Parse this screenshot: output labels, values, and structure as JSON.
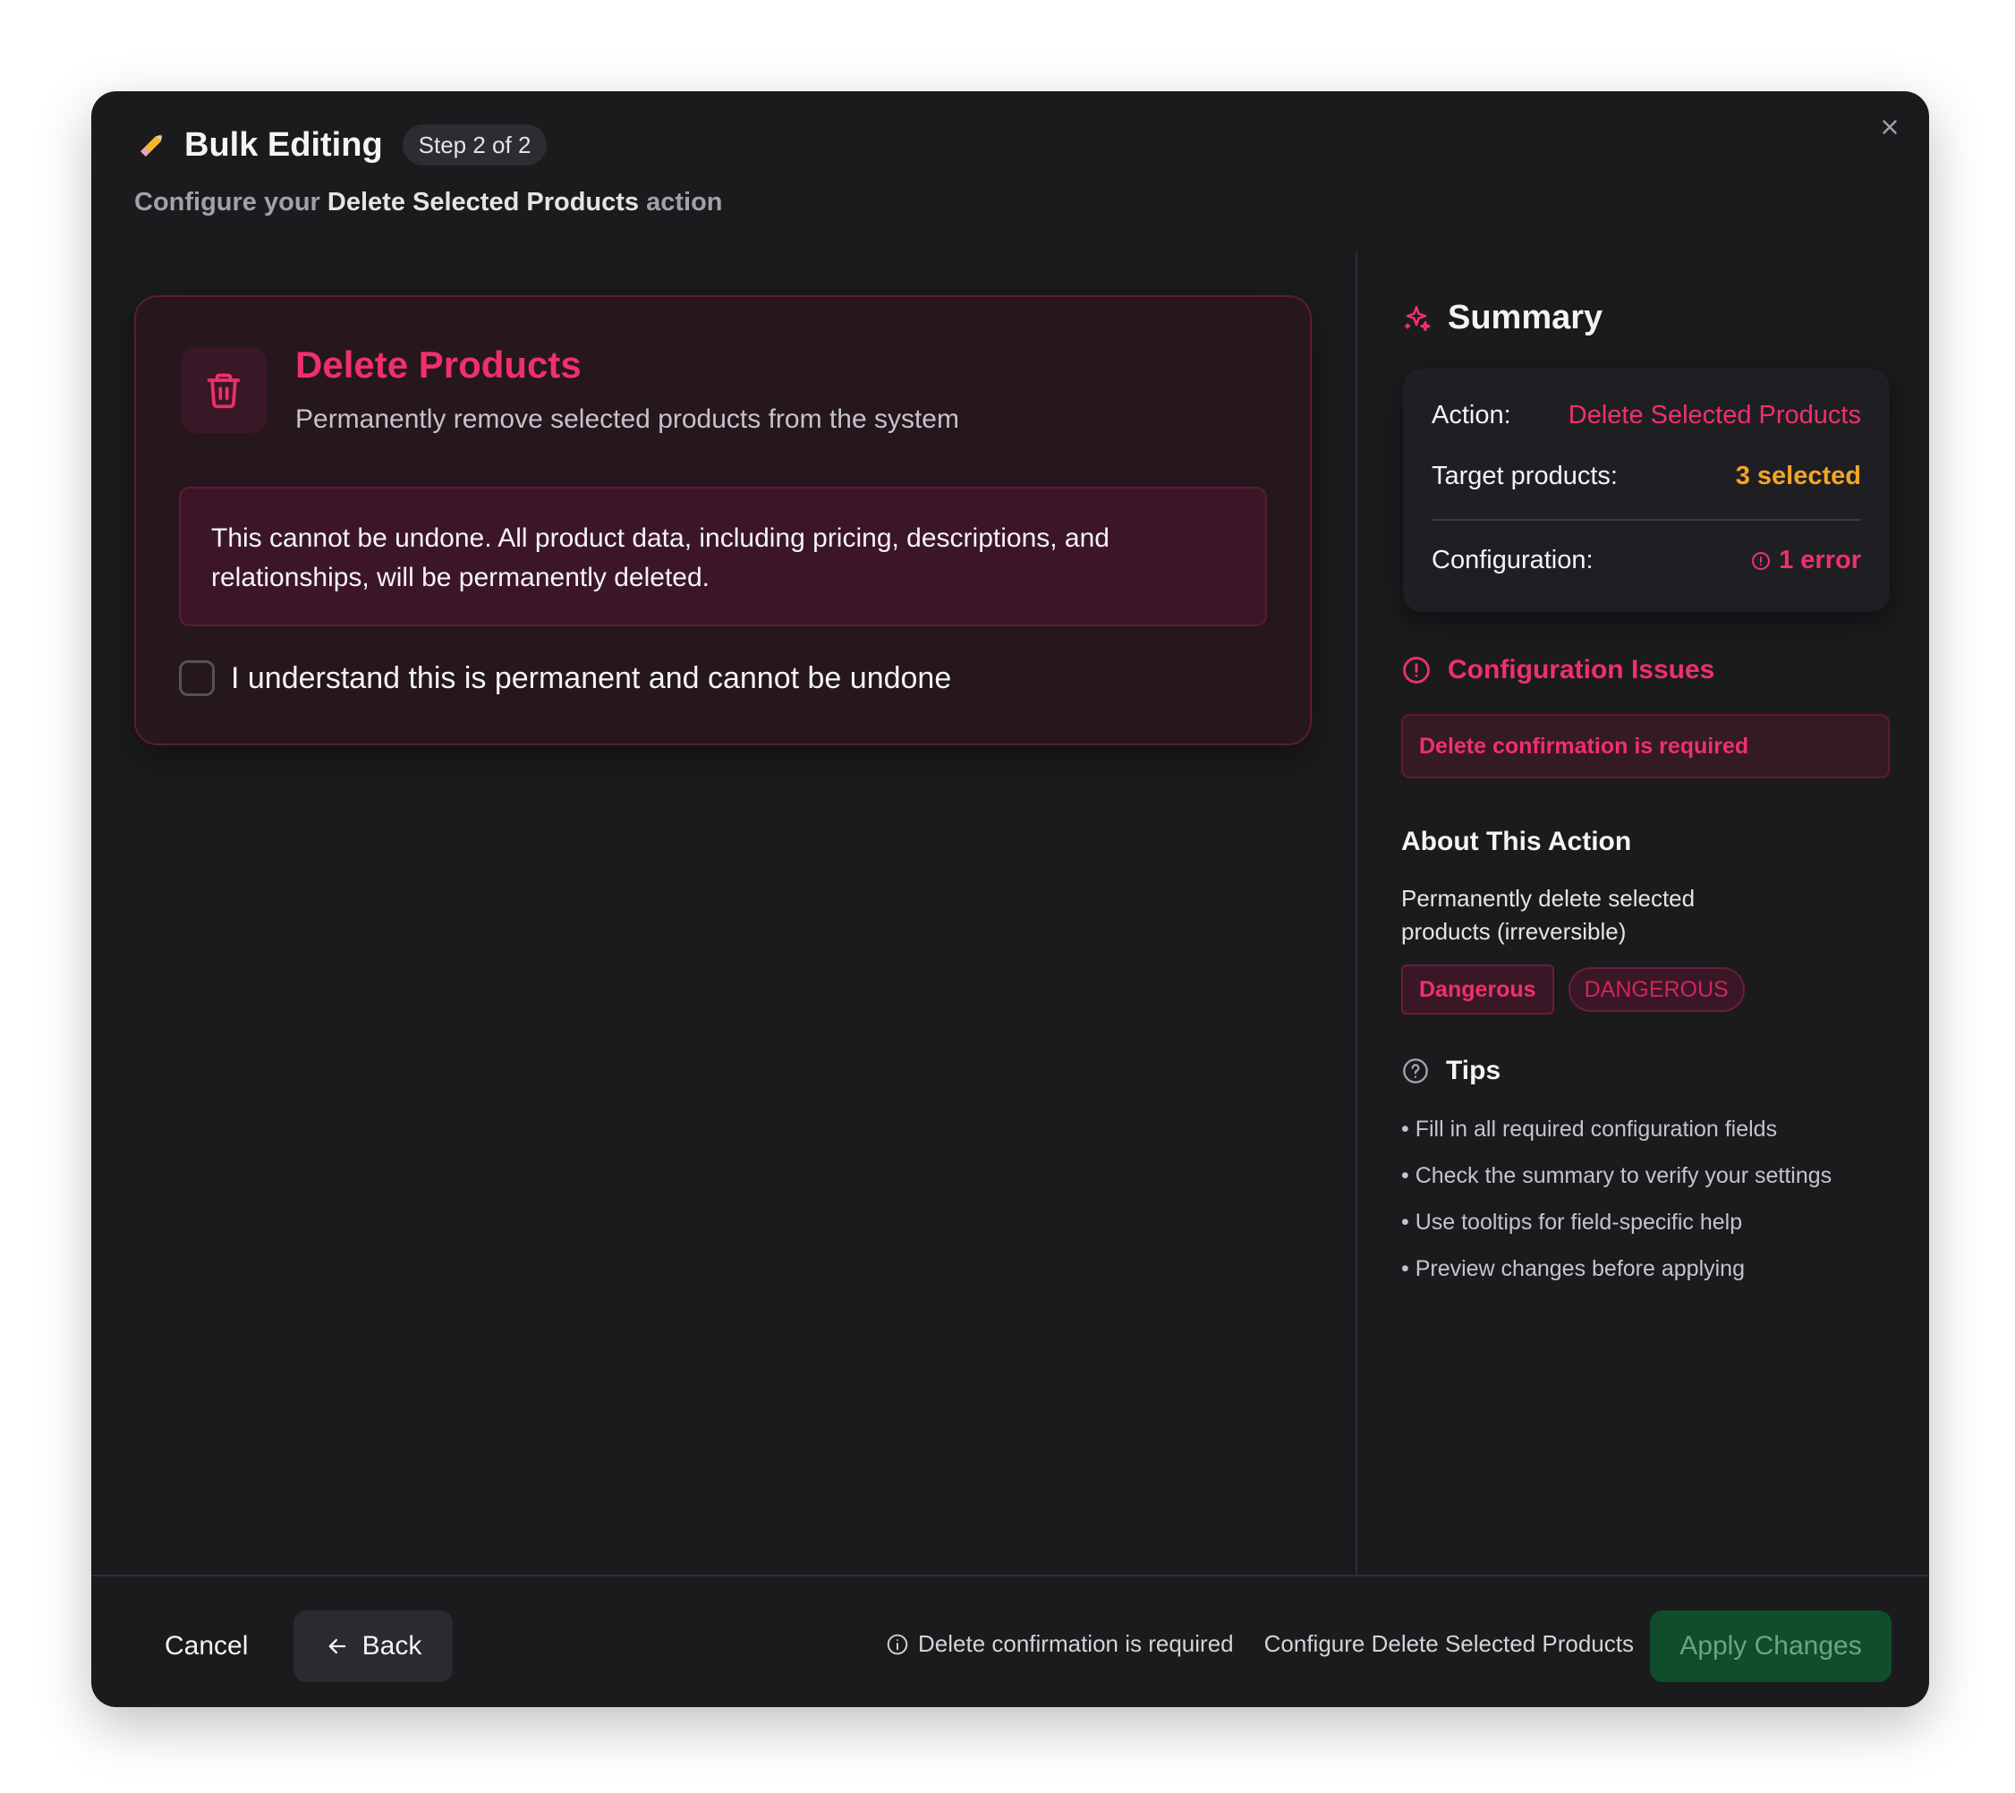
{
  "header": {
    "title": "Bulk Editing",
    "step": "Step 2 of 2",
    "subtitle_prefix": "Configure your",
    "subtitle_action": "Delete Selected Products",
    "subtitle_suffix": "action"
  },
  "action_card": {
    "title": "Delete Products",
    "description": "Permanently remove selected products from the system",
    "warning": "This cannot be undone. All product data, including pricing, descriptions, and relationships, will be permanently deleted.",
    "confirm_label": "I understand this is permanent and cannot be undone",
    "confirm_checked": false
  },
  "summary": {
    "title": "Summary",
    "action_key": "Action:",
    "action_value": "Delete Selected Products",
    "target_key": "Target products:",
    "target_value": "3 selected",
    "config_key": "Configuration:",
    "config_value": "1 error"
  },
  "issues": {
    "title": "Configuration Issues",
    "items": [
      "Delete confirmation is required"
    ]
  },
  "about": {
    "title": "About This Action",
    "description": "Permanently delete selected products (irreversible)",
    "badges": [
      "Dangerous",
      "DANGEROUS"
    ]
  },
  "tips": {
    "title": "Tips",
    "items": [
      "• Fill in all required configuration fields",
      "• Check the summary to verify your settings",
      "• Use tooltips for field-specific help",
      "• Preview changes before applying"
    ]
  },
  "footer": {
    "cancel": "Cancel",
    "back": "Back",
    "status_error": "Delete confirmation is required",
    "status_action": "Configure Delete Selected Products",
    "apply": "Apply Changes"
  },
  "colors": {
    "accent_red": "#f0306b",
    "accent_amber": "#f5a524",
    "apply_green": "#0f4d2b",
    "modal_bg": "#1b1b1e"
  },
  "icons": {
    "title": "pencil-icon",
    "card": "trash-icon",
    "summary": "sparkles-icon",
    "issues": "alert-circle-icon",
    "tips": "help-circle-icon",
    "back": "arrow-left-icon",
    "close": "close-icon"
  }
}
